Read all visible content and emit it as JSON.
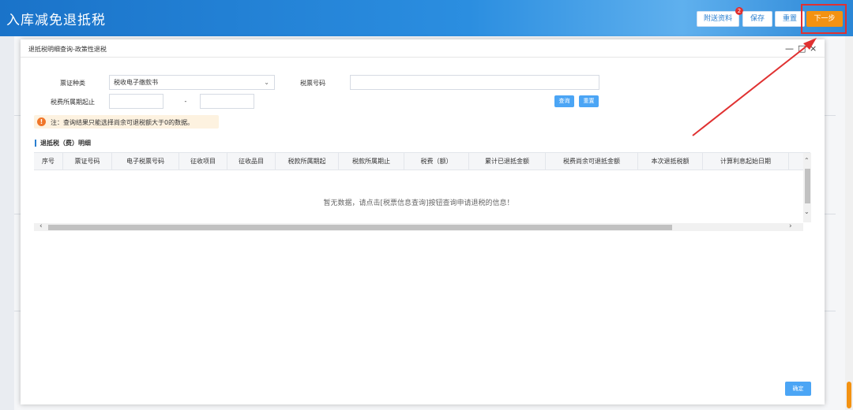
{
  "header": {
    "title": "入库减免退抵税",
    "buttons": {
      "attach": "附送资料",
      "attach_badge": "2",
      "save": "保存",
      "reset": "重置",
      "next": "下一步"
    }
  },
  "modal": {
    "title": "退抵税明细查询-政策性退税",
    "controls": {
      "minimize": "—",
      "maximize": "□",
      "close": "×"
    },
    "form": {
      "ticket_type_label": "票证种类",
      "ticket_type_value": "税收电子缴款书",
      "tax_ticket_no_label": "税票号码",
      "tax_ticket_no_value": "",
      "period_label": "税费所属期起止",
      "period_start": "",
      "period_sep": "-",
      "period_end": "",
      "query_button": "查询",
      "reset_button": "重置"
    },
    "notice": "注：查询结果只能选择尚余可退税额大于0的数据。",
    "section_title": "退抵税（费）明细",
    "table": {
      "columns": [
        "序号",
        "票证号码",
        "电子税票号码",
        "征收项目",
        "征收品目",
        "税款所属期起",
        "税款所属期止",
        "税费（额）",
        "累计已退抵金额",
        "税费尚余可退抵金额",
        "本次退抵税额",
        "计算利息起始日期"
      ],
      "empty_text": "暂无数据，请点击[税票信息查询]按钮查询申请退税的信息！"
    },
    "confirm_button": "确定"
  },
  "colors": {
    "header_blue": "#1a73c9",
    "primary_orange": "#f39212",
    "button_blue": "#4ba5f5",
    "highlight_red": "#e03131"
  }
}
